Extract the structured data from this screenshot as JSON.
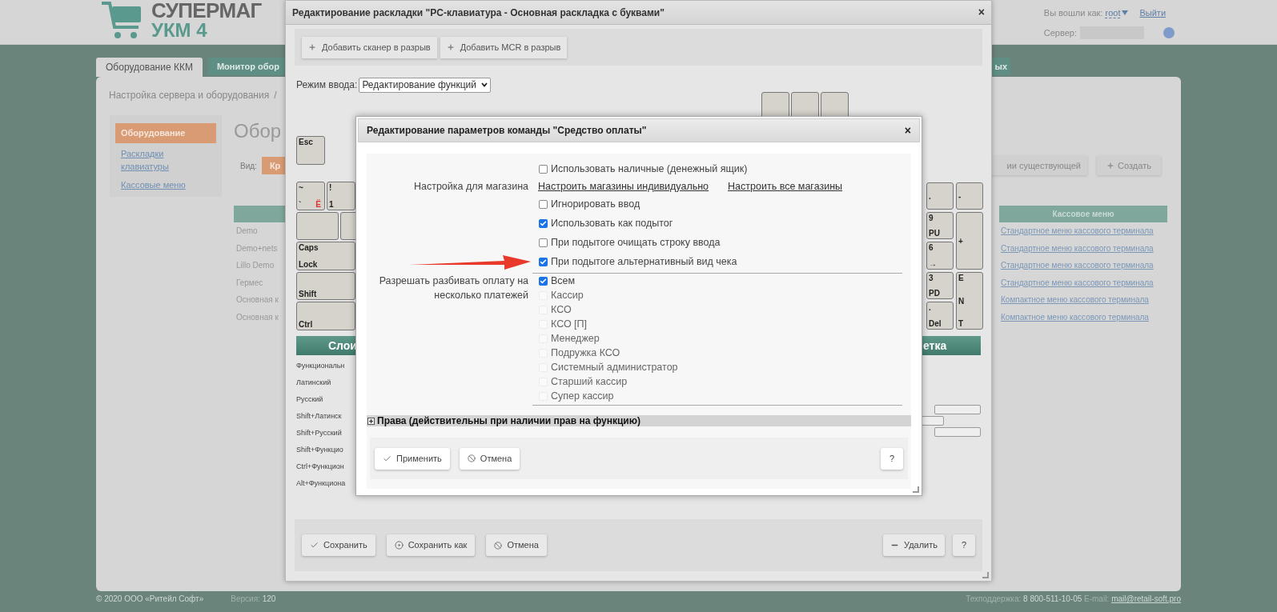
{
  "header": {
    "logo_line1": "СУПЕРМАГ",
    "logo_line2": "УКМ 4",
    "user_label": "Вы вошли как:",
    "user": "root",
    "logout": "Выйти",
    "server_label": "Сервер:"
  },
  "nav_tabs": [
    {
      "label": "Оборудование ККМ",
      "selected": true
    },
    {
      "label": "Монитор обор",
      "selected": false
    }
  ],
  "nav_tab_right": {
    "label": "ых",
    "selected": false
  },
  "breadcrumb": [
    "Настройка сервера и оборудования",
    "/"
  ],
  "sidebar": {
    "items": [
      {
        "label": "Оборудование",
        "selected": true
      },
      {
        "label": "Раскладки клавиатуры",
        "selected": false
      },
      {
        "label": "Кассовые меню",
        "selected": false
      }
    ]
  },
  "page_heading": "Обор",
  "view": {
    "label": "Вид:",
    "button": "Кр"
  },
  "copy_button": "ии существующей",
  "create_button": "Создать",
  "layouts_table": {
    "names": [
      "Demo",
      "Demo+nets",
      "Lillo Demo",
      "Гермес",
      "Основная к",
      "Основная к"
    ],
    "menu_heading": "Кассовое меню",
    "menus": [
      "Стандартное меню кассового терминала",
      "Стандартное меню кассового терминала",
      "Стандартное меню кассового терминала",
      "Стандартное меню кассового терминала",
      "Компактное меню кассового терминала",
      "Компактное меню кассового терминала"
    ]
  },
  "footer": {
    "copyright": "© 2020 ООО «Ритейл Софт»",
    "version_label": "Версия:",
    "version": "120",
    "support_label": "Техподдержка:",
    "support_phone": "8 800-511-10-05",
    "email_label": "E-mail:",
    "email": "mail@retail-soft.pro"
  },
  "layout_dialog": {
    "title": "Редактирование раскладки \"PC-клавиатура - Основная раскладка с буквами\"",
    "close": "×",
    "toolbar": [
      "Добавить сканер в разрыв",
      "Добавить MCR в разрыв"
    ],
    "mode_label": "Режим ввода:",
    "mode_value": "Редактирование функций",
    "keys": [
      {
        "lines": [
          "Esc"
        ]
      },
      {
        "lines": [
          "~",
          "`"
        ],
        "alt": "Ё"
      },
      {
        "lines": [
          "!",
          "1"
        ]
      },
      {
        "lines": [
          "Caps",
          "Lock"
        ]
      },
      {
        "lines": [
          "Shift"
        ]
      },
      {
        "lines": [
          "Ctrl"
        ]
      },
      {
        "lines": [
          "."
        ]
      },
      {
        "lines": [
          "-"
        ]
      },
      {
        "lines": [
          "9",
          "PU"
        ]
      },
      {
        "lines": [
          "+"
        ]
      },
      {
        "lines": [
          "6",
          "→"
        ]
      },
      {
        "lines": [
          "3",
          "PD"
        ]
      },
      {
        "lines": [
          ".",
          "Del"
        ]
      },
      {
        "lines": [
          "E",
          "N",
          "T"
        ]
      }
    ],
    "layers_heading": "Слои",
    "layers": [
      "Функциональн",
      "Латинский",
      "Русский",
      "Shift+Латинск",
      "Shift+Русский",
      "Shift+Функцио",
      "Ctrl+Функцион",
      "Alt+Функциона"
    ],
    "grid_heading": "етка",
    "buttons": [
      {
        "label": "Сохранить",
        "kind": "check"
      },
      {
        "label": "Сохранить как",
        "kind": "disk"
      },
      {
        "label": "Отмена",
        "kind": "cancel"
      },
      {
        "label": "Удалить",
        "kind": "delete"
      },
      {
        "label": "?",
        "kind": "help"
      }
    ]
  },
  "command_dialog": {
    "title": "Редактирование параметров команды \"Средство оплаты\"",
    "close": "×",
    "rows": [
      {
        "kind": "checkbox",
        "text": "Использовать наличные (денежный ящик)",
        "checked": false
      },
      {
        "kind": "links",
        "label": "Настройка для магазина",
        "links": [
          "Настроить магазины индивидуально",
          "Настроить все магазины"
        ]
      },
      {
        "kind": "checkbox",
        "text": "Игнорировать ввод",
        "checked": false
      },
      {
        "kind": "checkbox",
        "text": "Использовать как подытог",
        "checked": true
      },
      {
        "kind": "checkbox",
        "text": "При подытоге очищать строку ввода",
        "checked": false
      },
      {
        "kind": "checkbox",
        "text": "При подытоге альтернативный вид чека",
        "checked": true
      }
    ],
    "split": {
      "label": "Разрешать разбивать оплату на несколько платежей",
      "roles": [
        {
          "text": "Всем",
          "checked": true,
          "disabled": false
        },
        {
          "text": "Кассир",
          "checked": false,
          "disabled": true
        },
        {
          "text": "КСО",
          "checked": false,
          "disabled": true
        },
        {
          "text": "КСО [П]",
          "checked": false,
          "disabled": true
        },
        {
          "text": "Менеджер",
          "checked": false,
          "disabled": true
        },
        {
          "text": "Подружка КСО",
          "checked": false,
          "disabled": true
        },
        {
          "text": "Системный администратор",
          "checked": false,
          "disabled": true
        },
        {
          "text": "Старший кассир",
          "checked": false,
          "disabled": true
        },
        {
          "text": "Супер кассир",
          "checked": false,
          "disabled": true
        }
      ]
    },
    "rights": {
      "text": "Права (действительны при наличии прав на функцию)",
      "expanded": false
    },
    "buttons": [
      {
        "label": "Применить",
        "kind": "check"
      },
      {
        "label": "Отмена",
        "kind": "cancel"
      },
      {
        "label": "?",
        "kind": "help"
      }
    ]
  }
}
